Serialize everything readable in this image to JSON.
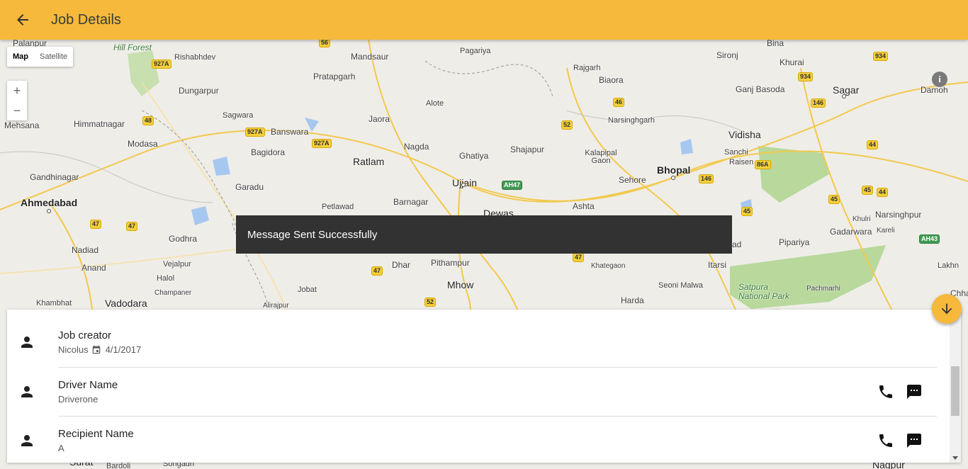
{
  "header": {
    "title": "Job Details",
    "back_icon": "arrow-back-icon"
  },
  "map": {
    "type_buttons": [
      "Map",
      "Satellite"
    ],
    "zoom_in": "+",
    "zoom_out": "−",
    "info_label": "i",
    "places": [
      {
        "name": "Palanpur"
      },
      {
        "name": "Hill Forest"
      },
      {
        "name": "Rishabhdev"
      },
      {
        "name": "Mandsaur"
      },
      {
        "name": "Pagariya"
      },
      {
        "name": "Sironj"
      },
      {
        "name": "Bina"
      },
      {
        "name": "Khurai"
      },
      {
        "name": "Rajgarh"
      },
      {
        "name": "Pratapgarh"
      },
      {
        "name": "Biaora"
      },
      {
        "name": "Ganj Basoda"
      },
      {
        "name": "Sagar"
      },
      {
        "name": "Damoh"
      },
      {
        "name": "Dungarpur"
      },
      {
        "name": "Alote"
      },
      {
        "name": "Mehsana"
      },
      {
        "name": "Himmatnagar"
      },
      {
        "name": "Sagwara"
      },
      {
        "name": "Jaora"
      },
      {
        "name": "Narsinghgarh"
      },
      {
        "name": "Vidisha"
      },
      {
        "name": "Banswara"
      },
      {
        "name": "Modasa"
      },
      {
        "name": "Bagidora"
      },
      {
        "name": "Nagda"
      },
      {
        "name": "Shajapur"
      },
      {
        "name": "Sanchi"
      },
      {
        "name": "Ghatiya"
      },
      {
        "name": "Kalapipal Gaon"
      },
      {
        "name": "Raisen"
      },
      {
        "name": "Ratlam"
      },
      {
        "name": "Bhopal"
      },
      {
        "name": "Gandhinagar"
      },
      {
        "name": "Ujjain"
      },
      {
        "name": "Sehore"
      },
      {
        "name": "Garadu"
      },
      {
        "name": "Ahmedabad"
      },
      {
        "name": "Petlawad"
      },
      {
        "name": "Barnagar"
      },
      {
        "name": "Ashta"
      },
      {
        "name": "Dewas"
      },
      {
        "name": "Narsinghpur"
      },
      {
        "name": "Khulri"
      },
      {
        "name": "Gadarwara"
      },
      {
        "name": "Kareli"
      },
      {
        "name": "Godhra"
      },
      {
        "name": "Nadiad"
      },
      {
        "name": "Pipariya"
      },
      {
        "name": "Vejalpur"
      },
      {
        "name": "Anand"
      },
      {
        "name": "Dhar"
      },
      {
        "name": "Pithampur"
      },
      {
        "name": "Khategaon"
      },
      {
        "name": "Itarsi"
      },
      {
        "name": "Lakhn"
      },
      {
        "name": "Halol"
      },
      {
        "name": "Mhow"
      },
      {
        "name": "Seoni Malwa"
      },
      {
        "name": "Satpura National Park"
      },
      {
        "name": "Pachmarhi"
      },
      {
        "name": "Champaner"
      },
      {
        "name": "Jobat"
      },
      {
        "name": "Chhana"
      },
      {
        "name": "Khambhat"
      },
      {
        "name": "Vadodara"
      },
      {
        "name": "Alirajpur"
      },
      {
        "name": "Harda"
      },
      {
        "name": "ad"
      },
      {
        "name": "Surat"
      },
      {
        "name": "Songadh"
      },
      {
        "name": "Nagpur"
      },
      {
        "name": "Bardoli"
      }
    ],
    "shields": [
      "56",
      "927A",
      "48",
      "927A",
      "927A",
      "46",
      "52",
      "934",
      "934",
      "146",
      "44",
      "86A",
      "146",
      "45",
      "44",
      "45",
      "45",
      "AH47",
      "47",
      "47",
      "47",
      "47",
      "52",
      "AH43"
    ]
  },
  "snackbar": {
    "message": "Message Sent Successfully"
  },
  "fab": {
    "icon": "arrow-down-icon"
  },
  "details": {
    "rows": [
      {
        "title": "Job creator",
        "subtitle": "Nicolus",
        "date": "4/1/2017",
        "icon": "person-icon",
        "has_actions": false
      },
      {
        "title": "Driver Name",
        "subtitle": "Driverone",
        "icon": "person-icon",
        "has_actions": true
      },
      {
        "title": "Recipient Name",
        "subtitle": "A",
        "icon": "person-icon",
        "has_actions": true
      }
    ],
    "action_icons": [
      "phone-icon",
      "message-icon"
    ]
  }
}
